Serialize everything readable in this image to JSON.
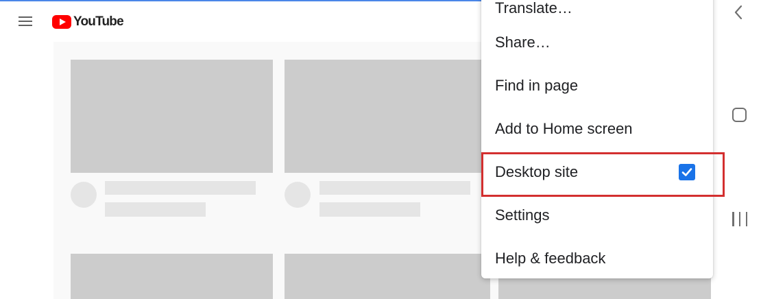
{
  "header": {
    "logo_text": "YouTube"
  },
  "menu": {
    "items": [
      {
        "label": "Translate…"
      },
      {
        "label": "Share…"
      },
      {
        "label": "Find in page"
      },
      {
        "label": "Add to Home screen"
      },
      {
        "label": "Desktop site",
        "checked": true
      },
      {
        "label": "Settings"
      },
      {
        "label": "Help & feedback"
      }
    ]
  },
  "colors": {
    "brand_red": "#ff0000",
    "checkbox_blue": "#1a73e8",
    "highlight_red": "#d32f2f",
    "skeleton_dark": "#cccccc",
    "skeleton_light": "#e5e5e5"
  },
  "system_nav": {
    "icons": [
      "back-icon",
      "home-icon",
      "recent-apps-icon"
    ]
  }
}
